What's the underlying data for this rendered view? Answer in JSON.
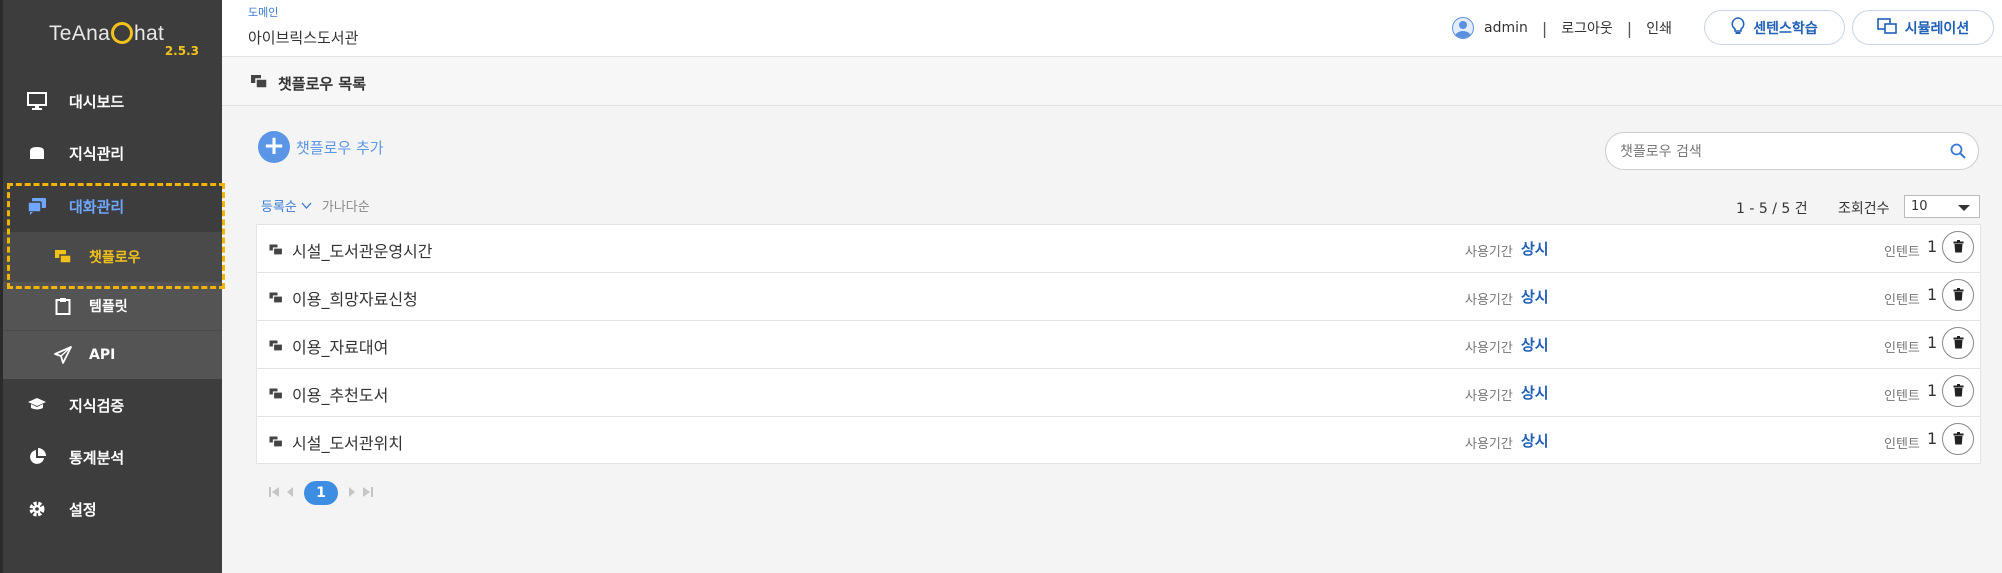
{
  "app": {
    "logo": "TeAna Chat",
    "logo_parts": [
      "TeAna",
      "hat"
    ],
    "version": "2.5.3"
  },
  "sidebar": {
    "items": [
      {
        "label": "대시보드",
        "icon": "monitor-icon"
      },
      {
        "label": "지식관리",
        "icon": "knowledge-icon"
      },
      {
        "label": "대화관리",
        "icon": "chat-icon",
        "active": true
      },
      {
        "label": "지식검증",
        "icon": "graduation-cap-icon"
      },
      {
        "label": "통계분석",
        "icon": "pie-chart-icon"
      },
      {
        "label": "설정",
        "icon": "gear-icon"
      }
    ],
    "subitems": [
      {
        "label": "챗플로우",
        "icon": "chatflow-icon",
        "current": true
      },
      {
        "label": "템플릿",
        "icon": "clipboard-icon"
      },
      {
        "label": "API",
        "icon": "paper-plane-icon"
      }
    ]
  },
  "header": {
    "domain_label": "도메인",
    "domain_name": "아이브릭스도서관",
    "user": "admin",
    "logout": "로그아웃",
    "print": "인쇄",
    "sentence_learning_button": "센텐스학습",
    "simulation_button": "시뮬레이션"
  },
  "page": {
    "title": "챗플로우 목록",
    "add_label": "챗플로우 추가",
    "search_placeholder": "챗플로우 검색",
    "sort_active": "등록순",
    "sort_other": "가나다순",
    "count": "1 - 5 / 5 건",
    "page_size_label": "조회건수",
    "page_size_value": "10"
  },
  "flows": [
    {
      "title": "시설_도서관운영시간",
      "period_label": "사용기간",
      "period": "상시",
      "intent_label": "인텐트",
      "intent_count": "1"
    },
    {
      "title": "이용_희망자료신청",
      "period_label": "사용기간",
      "period": "상시",
      "intent_label": "인텐트",
      "intent_count": "1"
    },
    {
      "title": "이용_자료대여",
      "period_label": "사용기간",
      "period": "상시",
      "intent_label": "인텐트",
      "intent_count": "1"
    },
    {
      "title": "이용_추천도서",
      "period_label": "사용기간",
      "period": "상시",
      "intent_label": "인텐트",
      "intent_count": "1"
    },
    {
      "title": "시설_도서관위치",
      "period_label": "사용기간",
      "period": "상시",
      "intent_label": "인텐트",
      "intent_count": "1"
    }
  ],
  "pagination": {
    "current_page": "1"
  },
  "colors": {
    "accent": "#3a7bd5",
    "highlight": "#f3b400",
    "sidebar_bg": "#3d3d3d"
  }
}
